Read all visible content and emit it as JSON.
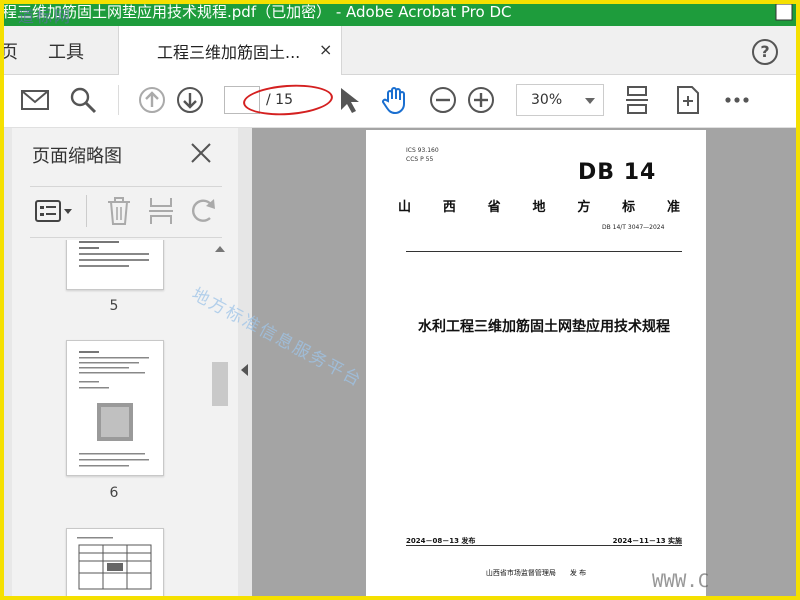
{
  "window": {
    "title": "程三维加筋固土网垫应用技术规程.pdf（已加密） - Adobe Acrobat Pro DC",
    "watermark_top": "道标网"
  },
  "tabs": {
    "home_partial": "页",
    "tools": "工具",
    "document": "工程三维加筋固土...",
    "close_glyph": "×",
    "help_glyph": "?"
  },
  "toolbar": {
    "current_page": "",
    "total_pages": "/ 15",
    "zoom_value": "30%"
  },
  "sidebar": {
    "title": "页面缩略图",
    "thumbnails": [
      {
        "label": "5"
      },
      {
        "label": "6"
      },
      {
        "label": ""
      }
    ]
  },
  "document": {
    "ics": "ICS 93.160",
    "ccs": "CCS P 55",
    "db_mark": "DB 14",
    "province_chars": [
      "山",
      "西",
      "省",
      "地",
      "方",
      "标",
      "准"
    ],
    "code": "DB 14/T 3047—2024",
    "title": "水利工程三维加筋固土网垫应用技术规程",
    "publish": "2024－08－13 发布",
    "implement": "2024－11－13 实施",
    "issuer": "山西省市场监督管理局",
    "issue_word": "发 布",
    "watermark_diag": "地方标准信息服务平台",
    "watermark_bottom": "WWW.C"
  },
  "colors": {
    "titlebar": "#1e9c3c",
    "frame": "#f5e000",
    "annotation": "#d42020",
    "doc_background": "#a4a4a4"
  }
}
